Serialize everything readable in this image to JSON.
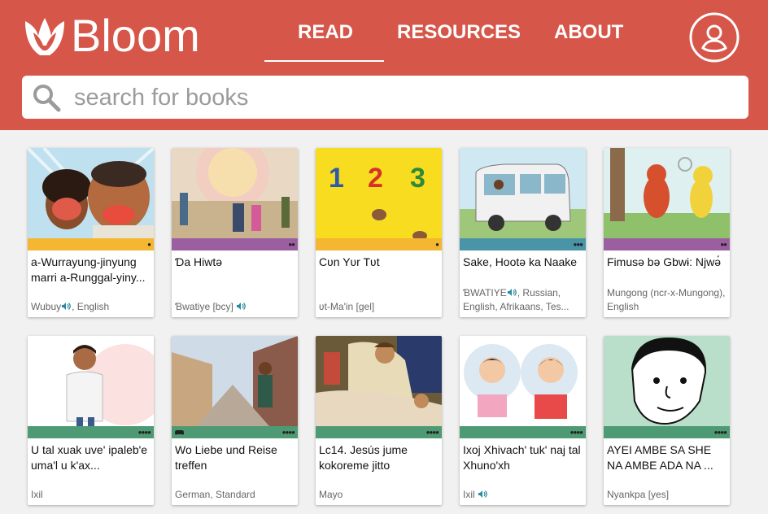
{
  "brand": {
    "name": "Bloom",
    "color": "#d65649"
  },
  "nav": {
    "read": "READ",
    "resources": "RESOURCES",
    "about": "ABOUT"
  },
  "search": {
    "placeholder": "search for books"
  },
  "books": [
    {
      "title": "a-Wurrayung-jinyung marri a-Runggal-yiny...",
      "language": "Wubuy",
      "language_rest": ", English",
      "audio": true,
      "level_color": "#f5b731",
      "dots": "●"
    },
    {
      "title": "Ɗa Hiwtə",
      "language": "Ɓwatiye [bcy]",
      "language_rest": "",
      "audio": true,
      "level_color": "#9b5fa1",
      "dots": "●●"
    },
    {
      "title": "Cʋn Yʋr Tʋt",
      "language": "ʋt-Ma'in [gel]",
      "language_rest": "",
      "audio": false,
      "level_color": "#f5b731",
      "dots": "●"
    },
    {
      "title": "Sake, Hootə ka Naake",
      "language": "ƁWATIYE",
      "language_rest": ", Russian, English, Afrikaans, Tes...",
      "audio": true,
      "level_color": "#4a94a8",
      "dots": "●●●"
    },
    {
      "title": "Fimusə bə Gbwɨ: Njwə́",
      "language": "Mungong (ncr-x-Mungong), English",
      "language_rest": "",
      "audio": false,
      "level_color": "#9b5fa1",
      "dots": "●●"
    },
    {
      "title": "U tal xuak uve' ipaleb'e uma'l u k'ax...",
      "language": "Ixil",
      "language_rest": "",
      "audio": false,
      "level_color": "#4e9a74",
      "dots": "●●●●"
    },
    {
      "title": "Wo Liebe und Reise treffen",
      "language": "German, Standard",
      "language_rest": "",
      "audio": false,
      "level_color": "#4e9a74",
      "dots": "●●●●",
      "game": true
    },
    {
      "title": "Lc14. Jesús jume kokoreme jitto",
      "language": "Mayo",
      "language_rest": "",
      "audio": false,
      "level_color": "#4e9a74",
      "dots": "●●●●"
    },
    {
      "title": "Ixoj Xhivach' tuk' naj tal Xhuno'xh",
      "language": "Ixil",
      "language_rest": "",
      "audio": true,
      "level_color": "#4e9a74",
      "dots": "●●●●"
    },
    {
      "title": "AYEI AMBE SA SHE NA AMBE ADA NA ...",
      "language": "Nyankpa [yes]",
      "language_rest": "",
      "audio": false,
      "level_color": "#4e9a74",
      "dots": "●●●●"
    }
  ]
}
